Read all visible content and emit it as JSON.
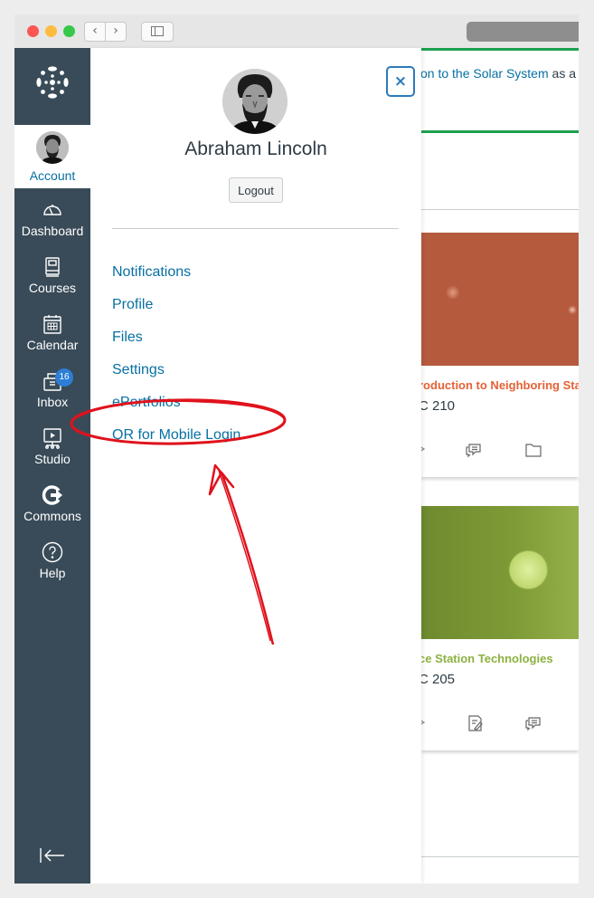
{
  "chrome": {
    "back_glyph": "‹",
    "forward_glyph": "›"
  },
  "global_nav": {
    "account_label": "Account",
    "items": [
      {
        "label": "Dashboard",
        "icon": "dashboard-icon"
      },
      {
        "label": "Courses",
        "icon": "courses-icon"
      },
      {
        "label": "Calendar",
        "icon": "calendar-icon"
      },
      {
        "label": "Inbox",
        "icon": "inbox-icon",
        "badge": "16"
      },
      {
        "label": "Studio",
        "icon": "studio-icon"
      },
      {
        "label": "Commons",
        "icon": "commons-icon"
      },
      {
        "label": "Help",
        "icon": "help-icon"
      }
    ]
  },
  "tray": {
    "user_name": "Abraham Lincoln",
    "logout_label": "Logout",
    "close_glyph": "×",
    "links": [
      "Notifications",
      "Profile",
      "Files",
      "Settings",
      "ePortfolios",
      "QR for Mobile Login"
    ]
  },
  "background": {
    "announcement_link": "on to the Solar System",
    "announcement_rest": " as a",
    "cards": [
      {
        "title": "roduction to Neighboring Sta",
        "code": "C 210",
        "color": "#e66135"
      },
      {
        "title": "ce Station Technologies",
        "code": "C 205",
        "color": "#8cb13f"
      }
    ]
  },
  "colors": {
    "nav_bg": "#394b58",
    "link": "#0770a3",
    "annotation": "#e0121c"
  }
}
